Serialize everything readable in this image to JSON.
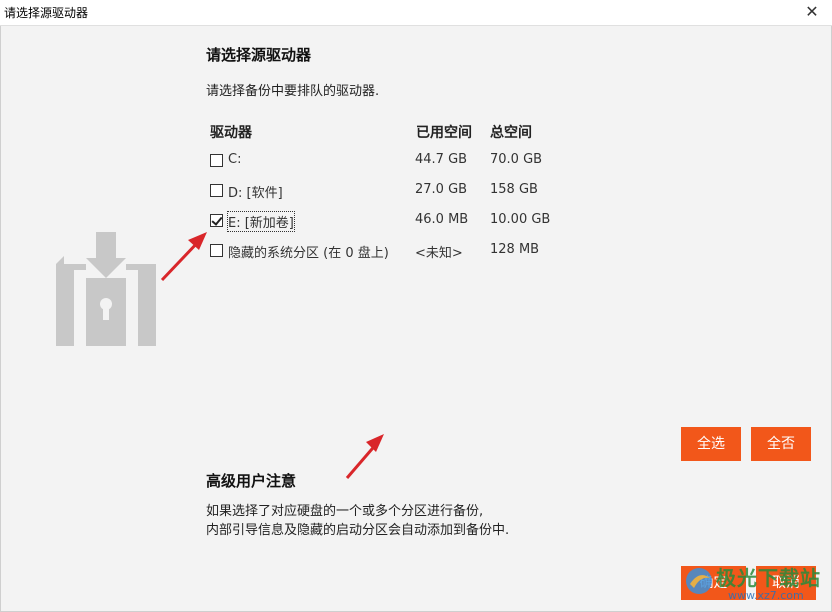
{
  "window": {
    "title": "请选择源驱动器",
    "close_glyph": "✕"
  },
  "main": {
    "heading": "请选择源驱动器",
    "subtext": "请选择备份中要排队的驱动器.",
    "columns": {
      "drive": "驱动器",
      "used": "已用空间",
      "total": "总空间"
    },
    "drives": [
      {
        "label": "C:",
        "used": "44.7 GB",
        "total": "70.0 GB",
        "checked": false
      },
      {
        "label": "D: [软件]",
        "used": "27.0 GB",
        "total": "158 GB",
        "checked": false
      },
      {
        "label": "E: [新加卷]",
        "used": "46.0 MB",
        "total": "10.00 GB",
        "checked": true
      },
      {
        "label": "隐藏的系统分区 (在 0 盘上)",
        "used": "<未知>",
        "total": "128 MB",
        "checked": false
      }
    ]
  },
  "buttons": {
    "select_all": "全选",
    "select_none": "全否",
    "ok": "确定",
    "cancel": "取消"
  },
  "advanced": {
    "title": "高级用户注意",
    "line1": "如果选择了对应硬盘的一个或多个分区进行备份,",
    "line2": "内部引导信息及隐藏的启动分区会自动添加到备份中."
  },
  "watermark": {
    "text": "极光下载站",
    "url": "www.xz7.com"
  },
  "colors": {
    "accent": "#f2571a",
    "arrow": "#d9262a",
    "illustration": "#c8c8c8",
    "background": "#f3f3f3"
  },
  "icons": [
    "close-icon",
    "drive-lock-illustration",
    "checkbox-icon",
    "checkmark-icon",
    "red-arrow",
    "watermark-logo"
  ]
}
